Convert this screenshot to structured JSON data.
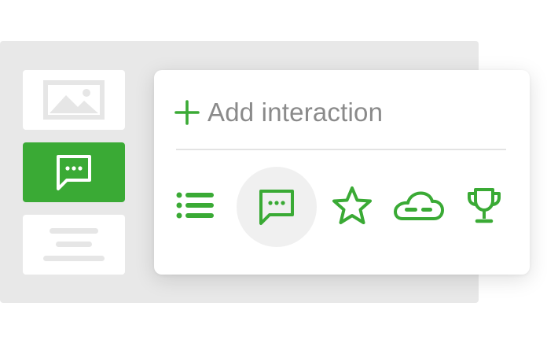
{
  "colors": {
    "accent": "#3aaa35",
    "backdrop": "#e8e8e8",
    "label": "#8a8a8a",
    "active_bg": "#f0f0f0"
  },
  "sidebar": {
    "items": [
      {
        "icon": "image-icon",
        "selected": false
      },
      {
        "icon": "chat-bubble-icon",
        "selected": true
      },
      {
        "icon": "text-lines-icon",
        "selected": false
      }
    ]
  },
  "card": {
    "add_label": "Add interaction",
    "tools": [
      {
        "icon": "list-icon",
        "active": false
      },
      {
        "icon": "chat-bubble-icon",
        "active": true
      },
      {
        "icon": "star-icon",
        "active": false
      },
      {
        "icon": "cloud-icon",
        "active": false
      },
      {
        "icon": "trophy-icon",
        "active": false
      }
    ]
  }
}
